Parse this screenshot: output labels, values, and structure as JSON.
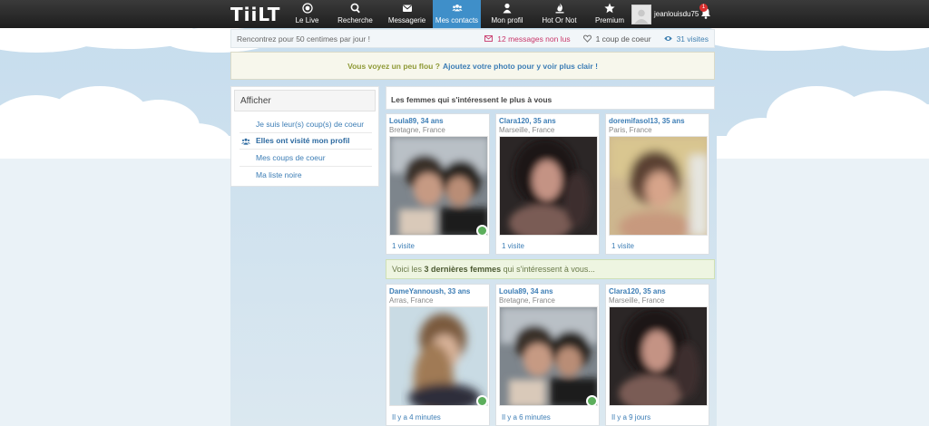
{
  "header": {
    "logo": "TiiLT",
    "nav": [
      {
        "label": "Le Live",
        "icon": "live-icon"
      },
      {
        "label": "Recherche",
        "icon": "search-icon"
      },
      {
        "label": "Messagerie",
        "icon": "envelope-icon"
      },
      {
        "label": "Mes contacts",
        "icon": "contacts-icon",
        "active": true
      },
      {
        "label": "Mon profil",
        "icon": "user-icon"
      },
      {
        "label": "Hot Or Not",
        "icon": "flame-icon"
      },
      {
        "label": "Premium",
        "icon": "star-icon"
      }
    ],
    "username": "jeanlouisdu75",
    "notif_count": "1"
  },
  "infobar": {
    "promo": "Rencontrez pour 50 centimes par jour !",
    "messages": "12 messages non lus",
    "hearts": "1 coup de coeur",
    "visits": "31 visites"
  },
  "notice": {
    "text": "Vous voyez un peu flou ?",
    "link": "Ajoutez votre photo pour y voir plus clair !"
  },
  "sidebar": {
    "title": "Afficher",
    "items": [
      {
        "label": "Je suis leur(s) coup(s) de coeur"
      },
      {
        "label": "Elles ont visité mon profil",
        "active": true
      },
      {
        "label": "Mes coups de coeur"
      },
      {
        "label": "Ma liste noire"
      }
    ]
  },
  "main": {
    "section_title": "Les femmes qui s'intéressent le plus à vous",
    "top_cards": [
      {
        "name": "Loula89, 34 ans",
        "location": "Bretagne, France",
        "footer": "1 visite",
        "online": true
      },
      {
        "name": "Clara120, 35 ans",
        "location": "Marseille, France",
        "footer": "1 visite",
        "online": false
      },
      {
        "name": "doremifasol13, 35 ans",
        "location": "Paris, France",
        "footer": "1 visite",
        "online": false
      }
    ],
    "banner": {
      "prefix": "Voici les",
      "bold": "3 dernières femmes",
      "suffix": "qui s'intéressent à vous..."
    },
    "recent_cards": [
      {
        "name": "DameYannoush, 33 ans",
        "location": "Arras, France",
        "footer": "Il y a 4 minutes",
        "online": true
      },
      {
        "name": "Loula89, 34 ans",
        "location": "Bretagne, France",
        "footer": "Il y a 6 minutes",
        "online": true
      },
      {
        "name": "Clara120, 35 ans",
        "location": "Marseille, France",
        "footer": "Il y a 9 jours",
        "online": false
      }
    ]
  },
  "colors": {
    "accent": "#3f8fc9",
    "link": "#3c7db5",
    "online": "#5cae5c",
    "messages": "#c8376a"
  }
}
